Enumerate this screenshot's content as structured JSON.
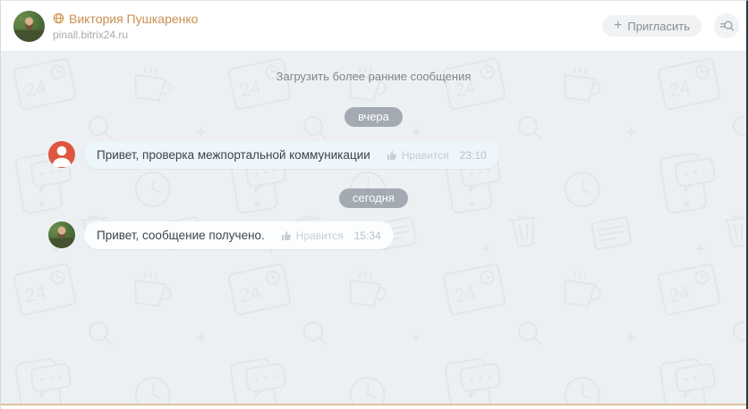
{
  "header": {
    "user_name": "Виктория Пушкаренко",
    "portal_domain": "pinall.bitrix24.ru",
    "invite_plus": "+",
    "invite_label": "Пригласить"
  },
  "chat": {
    "load_earlier_label": "Загрузить более ранние сообщения",
    "date_separators": [
      "вчера",
      "сегодня"
    ],
    "messages": [
      {
        "text": "Привет, проверка межпортальной коммуникации",
        "like_label": "Нравится",
        "time": "23:10"
      },
      {
        "text": "Привет, сообщение получено.",
        "like_label": "Нравится",
        "time": "15:34"
      }
    ]
  },
  "background": {
    "doodle_label": "24"
  },
  "icons": {
    "extranet": "globe-icon",
    "invite": "plus-icon",
    "search": "search-icon",
    "like": "thumb-up-icon",
    "sender": "person-icon"
  },
  "colors": {
    "extranet_name_orange": "#c98f4f",
    "sender_avatar_orange": "#dd5740",
    "date_badge_gray": "#a3aab2",
    "bubble_blue": "#edf6fb",
    "bubble_white": "#fcfdfe",
    "chat_background": "#edf0f3",
    "doodle_stroke": "#e1e6ea",
    "bottom_line_tan": "#ddc199"
  }
}
